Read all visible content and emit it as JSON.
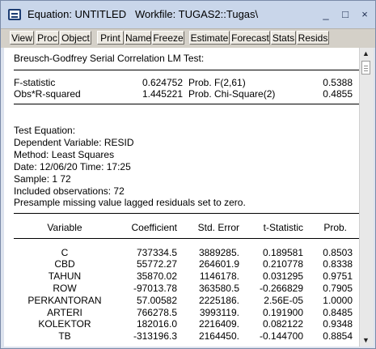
{
  "window": {
    "title": "Equation: UNTITLED   Workfile: TUGAS2::Tugas\\",
    "minimize": "_",
    "maximize": "□",
    "close": "×"
  },
  "toolbar": [
    "View",
    "Proc",
    "Object",
    "Print",
    "Name",
    "Freeze",
    "Estimate",
    "Forecast",
    "Stats",
    "Resids"
  ],
  "test": {
    "heading": "Breusch-Godfrey Serial Correlation LM Test:",
    "rows": [
      {
        "label": "F-statistic",
        "value": "0.624752",
        "prob_label": "Prob. F(2,61)",
        "prob": "0.5388"
      },
      {
        "label": "Obs*R-squared",
        "value": "1.445221",
        "prob_label": "Prob. Chi-Square(2)",
        "prob": "0.4855"
      }
    ]
  },
  "equation": {
    "lines": [
      "Test Equation:",
      "Dependent Variable: RESID",
      "Method: Least Squares",
      "Date: 12/06/20   Time: 17:25",
      "Sample: 1 72",
      "Included observations: 72",
      "Presample missing value lagged residuals set to zero."
    ]
  },
  "table": {
    "headers": [
      "Variable",
      "Coefficient",
      "Std. Error",
      "t-Statistic",
      "Prob."
    ],
    "rows": [
      [
        "C",
        "737334.5",
        "3889285.",
        "0.189581",
        "0.8503"
      ],
      [
        "CBD",
        "55772.27",
        "264601.9",
        "0.210778",
        "0.8338"
      ],
      [
        "TAHUN",
        "35870.02",
        "1146178.",
        "0.031295",
        "0.9751"
      ],
      [
        "ROW",
        "-97013.78",
        "363580.5",
        "-0.266829",
        "0.7905"
      ],
      [
        "PERKANTORAN",
        "57.00582",
        "2225186.",
        "2.56E-05",
        "1.0000"
      ],
      [
        "ARTERI",
        "766278.5",
        "3993119.",
        "0.191900",
        "0.8485"
      ],
      [
        "KOLEKTOR",
        "182016.0",
        "2216409.",
        "0.082122",
        "0.9348"
      ],
      [
        "TB",
        "-313196.3",
        "2164450.",
        "-0.144700",
        "0.8854"
      ]
    ]
  },
  "scrollbar": {
    "up": "▲",
    "down": "▼"
  }
}
